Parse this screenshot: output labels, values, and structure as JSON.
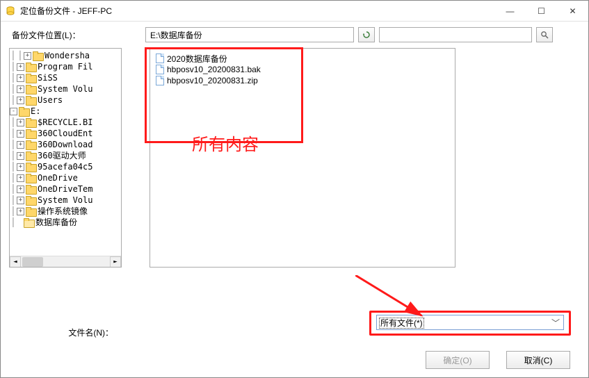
{
  "window": {
    "title": "定位备份文件 - JEFF-PC"
  },
  "location": {
    "label": "备份文件位置(L)：",
    "path": "E:\\数据库备份"
  },
  "search": {
    "placeholder": ""
  },
  "tree": {
    "items": [
      {
        "depth": 2,
        "expander": "+",
        "label": "Wondersha"
      },
      {
        "depth": 1,
        "expander": "+",
        "label": "Program Fil"
      },
      {
        "depth": 1,
        "expander": "+",
        "label": "SiSS"
      },
      {
        "depth": 1,
        "expander": "+",
        "label": "System Volu"
      },
      {
        "depth": 1,
        "expander": "+",
        "label": "Users"
      },
      {
        "depth": 0,
        "expander": "-",
        "label": "E:"
      },
      {
        "depth": 1,
        "expander": "+",
        "label": "$RECYCLE.BI"
      },
      {
        "depth": 1,
        "expander": "+",
        "label": "360CloudEnt"
      },
      {
        "depth": 1,
        "expander": "+",
        "label": "360Download"
      },
      {
        "depth": 1,
        "expander": "+",
        "label": "360驱动大师"
      },
      {
        "depth": 1,
        "expander": "+",
        "label": "95acefa04c5"
      },
      {
        "depth": 1,
        "expander": "+",
        "label": "OneDrive"
      },
      {
        "depth": 1,
        "expander": "+",
        "label": "OneDriveTem"
      },
      {
        "depth": 1,
        "expander": "+",
        "label": "System Volu"
      },
      {
        "depth": 1,
        "expander": "+",
        "label": "操作系统镜像"
      },
      {
        "depth": 1,
        "expander": "",
        "label": "数据库备份",
        "open": true
      }
    ]
  },
  "files": {
    "items": [
      {
        "name": "2020数据库备份"
      },
      {
        "name": "hbposv10_20200831.bak"
      },
      {
        "name": "hbposv10_20200831.zip"
      }
    ]
  },
  "annotation": {
    "text": "所有内容"
  },
  "footer": {
    "filename_label": "文件名(N)：",
    "filter_selected": "所有文件(*)",
    "ok": "确定(O)",
    "cancel": "取消(C)"
  }
}
